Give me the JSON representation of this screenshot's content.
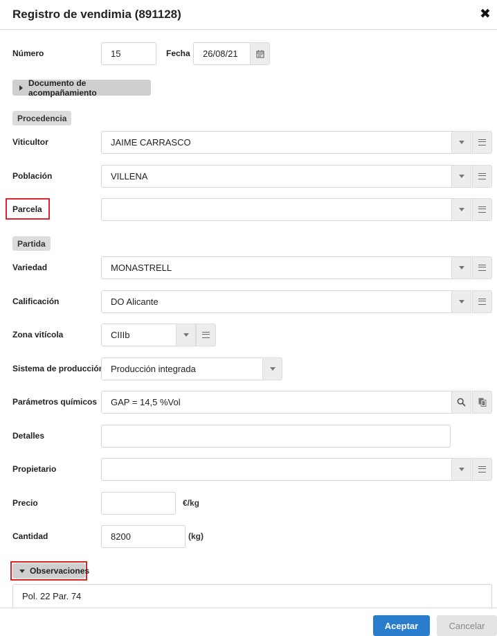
{
  "dialog": {
    "title": "Registro de vendimia (891128)",
    "close": "✖"
  },
  "numero": {
    "label": "Número",
    "value": "15"
  },
  "fecha": {
    "label": "Fecha",
    "value": "26/08/21"
  },
  "documento": {
    "label": "Documento de acompañamiento"
  },
  "sections": {
    "procedencia": "Procedencia",
    "partida": "Partida"
  },
  "viticultor": {
    "label": "Viticultor",
    "value": "JAIME CARRASCO"
  },
  "poblacion": {
    "label": "Población",
    "value": "VILLENA"
  },
  "parcela": {
    "label": "Parcela",
    "value": ""
  },
  "variedad": {
    "label": "Variedad",
    "value": "MONASTRELL"
  },
  "calificacion": {
    "label": "Calificación",
    "value": "DO Alicante"
  },
  "zona": {
    "label": "Zona vitícola",
    "value": "CIIIb"
  },
  "sistema": {
    "label": "Sistema de producción",
    "value": "Producción integrada"
  },
  "parametros": {
    "label": "Parámetros químicos",
    "value": "GAP = 14,5 %Vol"
  },
  "detalles": {
    "label": "Detalles",
    "value": ""
  },
  "propietario": {
    "label": "Propietario",
    "value": ""
  },
  "precio": {
    "label": "Precio",
    "value": "",
    "unit": "€/kg"
  },
  "cantidad": {
    "label": "Cantidad",
    "value": "8200",
    "unit": "(kg)"
  },
  "observaciones": {
    "label": "Observaciones",
    "value": "Pol. 22 Par. 74"
  },
  "footer": {
    "accept": "Aceptar",
    "cancel": "Cancelar"
  },
  "colors": {
    "primary": "#2a7ccc",
    "highlight": "#d9242c",
    "section_bg": "#dcdcdc"
  },
  "icons": {
    "calendar": "calendar-icon",
    "dropdown": "chevron-down-icon",
    "list": "list-icon",
    "search": "search-icon",
    "copy": "copy-icon"
  }
}
